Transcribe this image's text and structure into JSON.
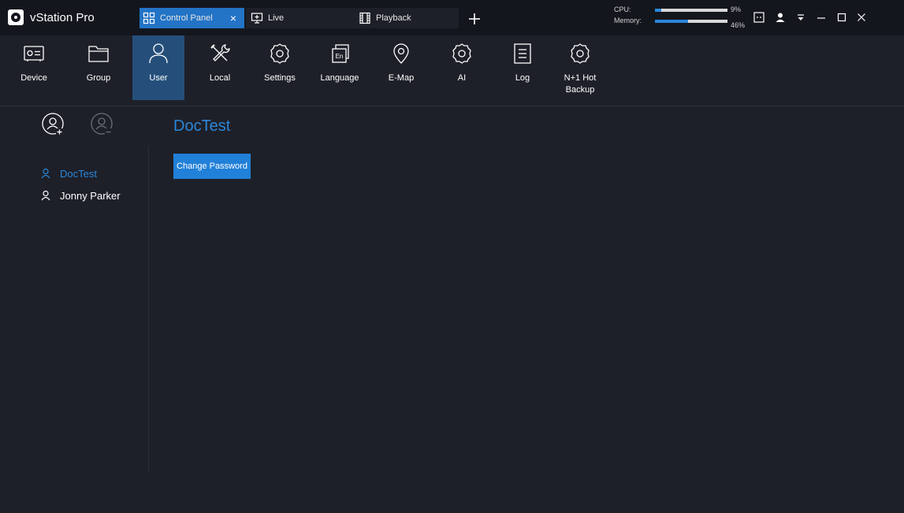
{
  "app": {
    "name": "vStation Pro"
  },
  "tabs": [
    {
      "label": "Control Panel",
      "close": "×"
    },
    {
      "label": "Live"
    },
    {
      "label": "Playback"
    }
  ],
  "add_tab_label": "+",
  "performance": {
    "cpu": {
      "label": "CPU:",
      "value": "9%",
      "percent": 9
    },
    "memory": {
      "label": "Memory:",
      "value": "46%",
      "percent": 46
    }
  },
  "toolbar": {
    "items": [
      {
        "label": "Device"
      },
      {
        "label": "Group"
      },
      {
        "label": "User"
      },
      {
        "label": "Local"
      },
      {
        "label": "Settings"
      },
      {
        "label": "Language"
      },
      {
        "label": "E-Map"
      },
      {
        "label": "AI"
      },
      {
        "label": "Log"
      },
      {
        "label": "N+1 Hot Backup"
      }
    ],
    "active": "User"
  },
  "users": [
    {
      "name": "DocTest",
      "selected": true
    },
    {
      "name": "Jonny Parker",
      "selected": false
    }
  ],
  "main": {
    "title": "DocTest",
    "change_password_label": "Change Password"
  },
  "colors": {
    "accent": "#2180d8",
    "titlebar": "#14161d",
    "background": "#1e2029",
    "active_tool": "#254f7a"
  },
  "icons": {
    "logo": "vstation-logo-icon",
    "control_panel": "grid-icon",
    "live": "monitor-icon",
    "playback": "film-icon",
    "add_user": "add-user-icon",
    "remove_user": "remove-user-icon"
  }
}
